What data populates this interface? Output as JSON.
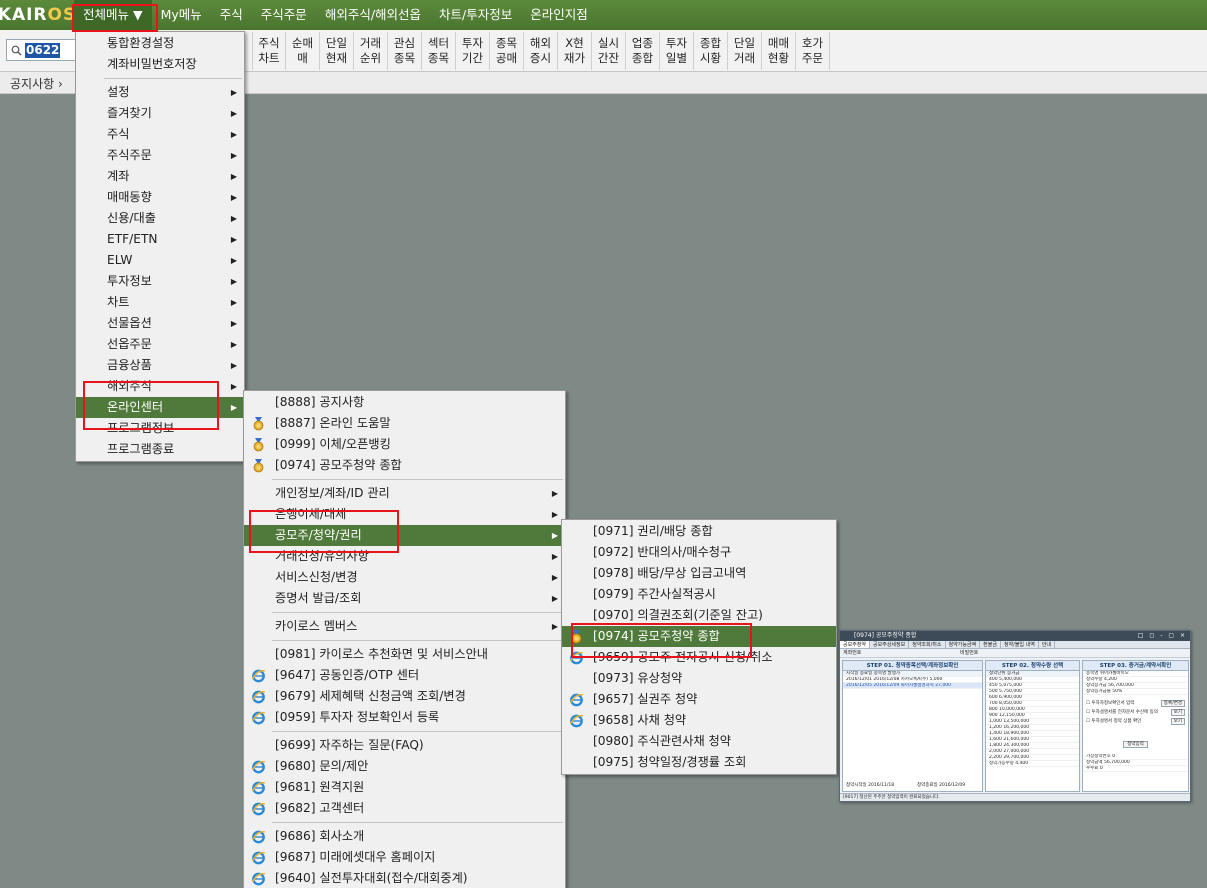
{
  "app": {
    "logo_main": "KAIR",
    "logo_accent": "OS"
  },
  "menubar": {
    "items": [
      {
        "label": "전체메뉴 ▼"
      },
      {
        "label": "My메뉴"
      },
      {
        "label": "주식"
      },
      {
        "label": "주식주문"
      },
      {
        "label": "해외주식/해외선옵"
      },
      {
        "label": "차트/투자정보"
      },
      {
        "label": "온라인지점"
      }
    ]
  },
  "toolbar": {
    "search_value": "0622",
    "buttons": [
      {
        "line1": "주식",
        "line2": "차트"
      },
      {
        "line1": "순매",
        "line2": "매"
      },
      {
        "line1": "단일",
        "line2": "현재"
      },
      {
        "line1": "거래",
        "line2": "순위"
      },
      {
        "line1": "관심",
        "line2": "종목"
      },
      {
        "line1": "섹터",
        "line2": "종목"
      },
      {
        "line1": "투자",
        "line2": "기간"
      },
      {
        "line1": "종목",
        "line2": "공매"
      },
      {
        "line1": "해외",
        "line2": "증시"
      },
      {
        "line1": "X현",
        "line2": "재가"
      },
      {
        "line1": "실시",
        "line2": "간잔"
      },
      {
        "line1": "업종",
        "line2": "종합"
      },
      {
        "line1": "투자",
        "line2": "일별"
      },
      {
        "line1": "종합",
        "line2": "시황"
      },
      {
        "line1": "단일",
        "line2": "거래"
      },
      {
        "line1": "매매",
        "line2": "현황"
      },
      {
        "line1": "호가",
        "line2": "주문"
      }
    ]
  },
  "breadcrumb": {
    "label": "공지사항 ›"
  },
  "menu1": {
    "items": [
      {
        "label": "통합환경설정"
      },
      {
        "label": "계좌비밀번호저장"
      },
      {
        "label": "설정"
      },
      {
        "label": "즐겨찾기"
      },
      {
        "label": "주식"
      },
      {
        "label": "주식주문"
      },
      {
        "label": "계좌"
      },
      {
        "label": "매매동향"
      },
      {
        "label": "신용/대출"
      },
      {
        "label": "ETF/ETN"
      },
      {
        "label": "ELW"
      },
      {
        "label": "투자정보"
      },
      {
        "label": "차트"
      },
      {
        "label": "선물옵션"
      },
      {
        "label": "선옵주문"
      },
      {
        "label": "금융상품"
      },
      {
        "label": "해외주식"
      },
      {
        "label": "온라인센터"
      },
      {
        "label": "프로그램정보"
      },
      {
        "label": "프로그램종료"
      }
    ]
  },
  "menu2": {
    "items": [
      {
        "label": "[8888] 공지사항"
      },
      {
        "label": "[8887] 온라인 도움말"
      },
      {
        "label": "[0999] 이체/오픈뱅킹"
      },
      {
        "label": "[0974] 공모주청약 종합"
      },
      {
        "label": "개인정보/계좌/ID 관리"
      },
      {
        "label": "은행이체/대체"
      },
      {
        "label": "공모주/청약/권리"
      },
      {
        "label": "거래신청/유의사항"
      },
      {
        "label": "서비스신청/변경"
      },
      {
        "label": "증명서 발급/조회"
      },
      {
        "label": "카이로스 멤버스"
      },
      {
        "label": "[0981] 카이로스 추천화면 및 서비스안내"
      },
      {
        "label": "[9647] 공동인증/OTP 센터"
      },
      {
        "label": "[9679] 세제혜택 신청금액 조회/변경"
      },
      {
        "label": "[0959] 투자자 정보확인서 등록"
      },
      {
        "label": "[9699] 자주하는 질문(FAQ)"
      },
      {
        "label": "[9680] 문의/제안"
      },
      {
        "label": "[9681] 원격지원"
      },
      {
        "label": "[9682] 고객센터"
      },
      {
        "label": "[9686] 회사소개"
      },
      {
        "label": "[9687] 미래에셋대우 홈페이지"
      },
      {
        "label": "[9640] 실전투자대회(접수/대회중계)"
      }
    ]
  },
  "menu3": {
    "items": [
      {
        "label": "[0971] 권리/배당 종합"
      },
      {
        "label": "[0972] 반대의사/매수청구"
      },
      {
        "label": "[0978] 배당/무상 입금고내역"
      },
      {
        "label": "[0979] 주간사실적공시"
      },
      {
        "label": "[0970] 의결권조회(기준일 잔고)"
      },
      {
        "label": "[0974] 공모주청약 종합"
      },
      {
        "label": "[9659] 공모주 전자공시 신청/취소"
      },
      {
        "label": "[0973] 유상청약"
      },
      {
        "label": "[9657] 실권주 청약"
      },
      {
        "label": "[9658] 사채 청약"
      },
      {
        "label": "[0980] 주식관련사채 청약"
      },
      {
        "label": "[0975] 청약일정/경쟁률 조회"
      }
    ]
  },
  "preview": {
    "title": "[0974] 공모주청약 종합",
    "controls": "□ ◻ - ▢ ×",
    "tabs": [
      "공모주청약",
      "공모주상세정보",
      "청약조회/취소",
      "청약가능금액",
      "환불금",
      "청약/불입 내역",
      "안내"
    ],
    "account_label": "계좌번호",
    "password_label": "비밀번호",
    "step1": {
      "title": "STEP 01. 청약종목선택/계좌정보확인",
      "header": "시작일   종료일   종목명   발행가",
      "rows": [
        "2016/12/01  2016/12/08  카카오톡A(주)  5,000",
        "2016/12/05  2016/12/09  화이자셀생명과학  27,000"
      ],
      "start_label": "청약시작일  2016/11/18",
      "end_label": "청약종료일  2016/12/09"
    },
    "step2": {
      "title": "STEP 02. 청약수량 선택",
      "header": "청약단위  증거금",
      "rows": [
        "400   5,400,000",
        "450   5,075,000",
        "500   5,750,000",
        "600   6,900,000",
        "700   8,050,000",
        "800   10,000,000",
        "900   12,150,000",
        "1,000  13,500,000",
        "1,200  16,200,000",
        "1,400  18,900,000",
        "1,600  21,600,000",
        "1,800  24,300,000",
        "2,000  27,000,000",
        "2,200  29,700,000",
        "청약가능수량  4,400"
      ]
    },
    "step3": {
      "title": "STEP 03. 증거금/계약서확인",
      "rows": [
        "종목명   위아카셀바이오",
        "청약수량   4,200",
        "청약증거금   56,700,000",
        "청약증거금률   50%"
      ],
      "checks": [
        {
          "label": "투자자정보확인서 입력",
          "btn": "등록/변경"
        },
        {
          "label": "투자설명서를 전자문서 수신에 동의",
          "btn": "보기"
        },
        {
          "label": "투자설명서 청약 상품 확인",
          "btn": "보기"
        }
      ],
      "submit": "청약입력",
      "bottom_rows": [
        "가상청약번호    0",
        "청약금액   56,700,000",
        "수수료    0"
      ]
    },
    "status": "[9017] 청산된 주주만 청약입력이 완료되었습니다."
  }
}
